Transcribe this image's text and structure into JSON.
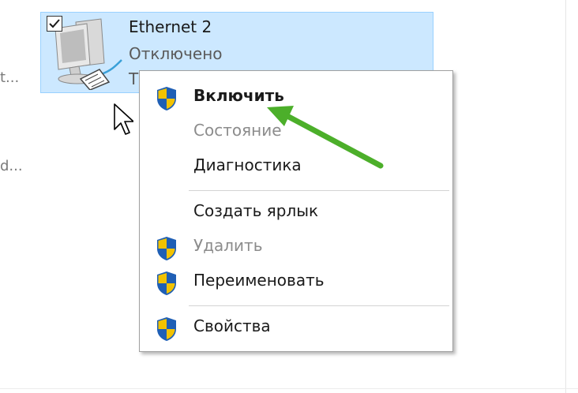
{
  "left_panel": {
    "truncated_text_1": "t...",
    "truncated_text_2": "d..."
  },
  "adapter": {
    "name": "Ethernet 2",
    "status": "Отключено",
    "device_partial": "T",
    "checked": true,
    "icon": "network-adapter-icon"
  },
  "context_menu": {
    "items": [
      {
        "label": "Включить",
        "shield": true,
        "bold": true,
        "disabled": false
      },
      {
        "label": "Состояние",
        "shield": false,
        "bold": false,
        "disabled": true
      },
      {
        "label": "Диагностика",
        "shield": false,
        "bold": false,
        "disabled": false
      },
      {
        "label": "Создать ярлык",
        "shield": false,
        "bold": false,
        "disabled": false
      },
      {
        "label": "Удалить",
        "shield": true,
        "bold": false,
        "disabled": true
      },
      {
        "label": "Переименовать",
        "shield": true,
        "bold": false,
        "disabled": false
      },
      {
        "label": "Свойства",
        "shield": true,
        "bold": false,
        "disabled": false
      }
    ]
  },
  "colors": {
    "selection_bg": "#cce8ff",
    "selection_border": "#99d1ff",
    "annotation_arrow": "#4caf2a",
    "shield_blue": "#1f5fb5",
    "shield_yellow": "#f2c200"
  }
}
